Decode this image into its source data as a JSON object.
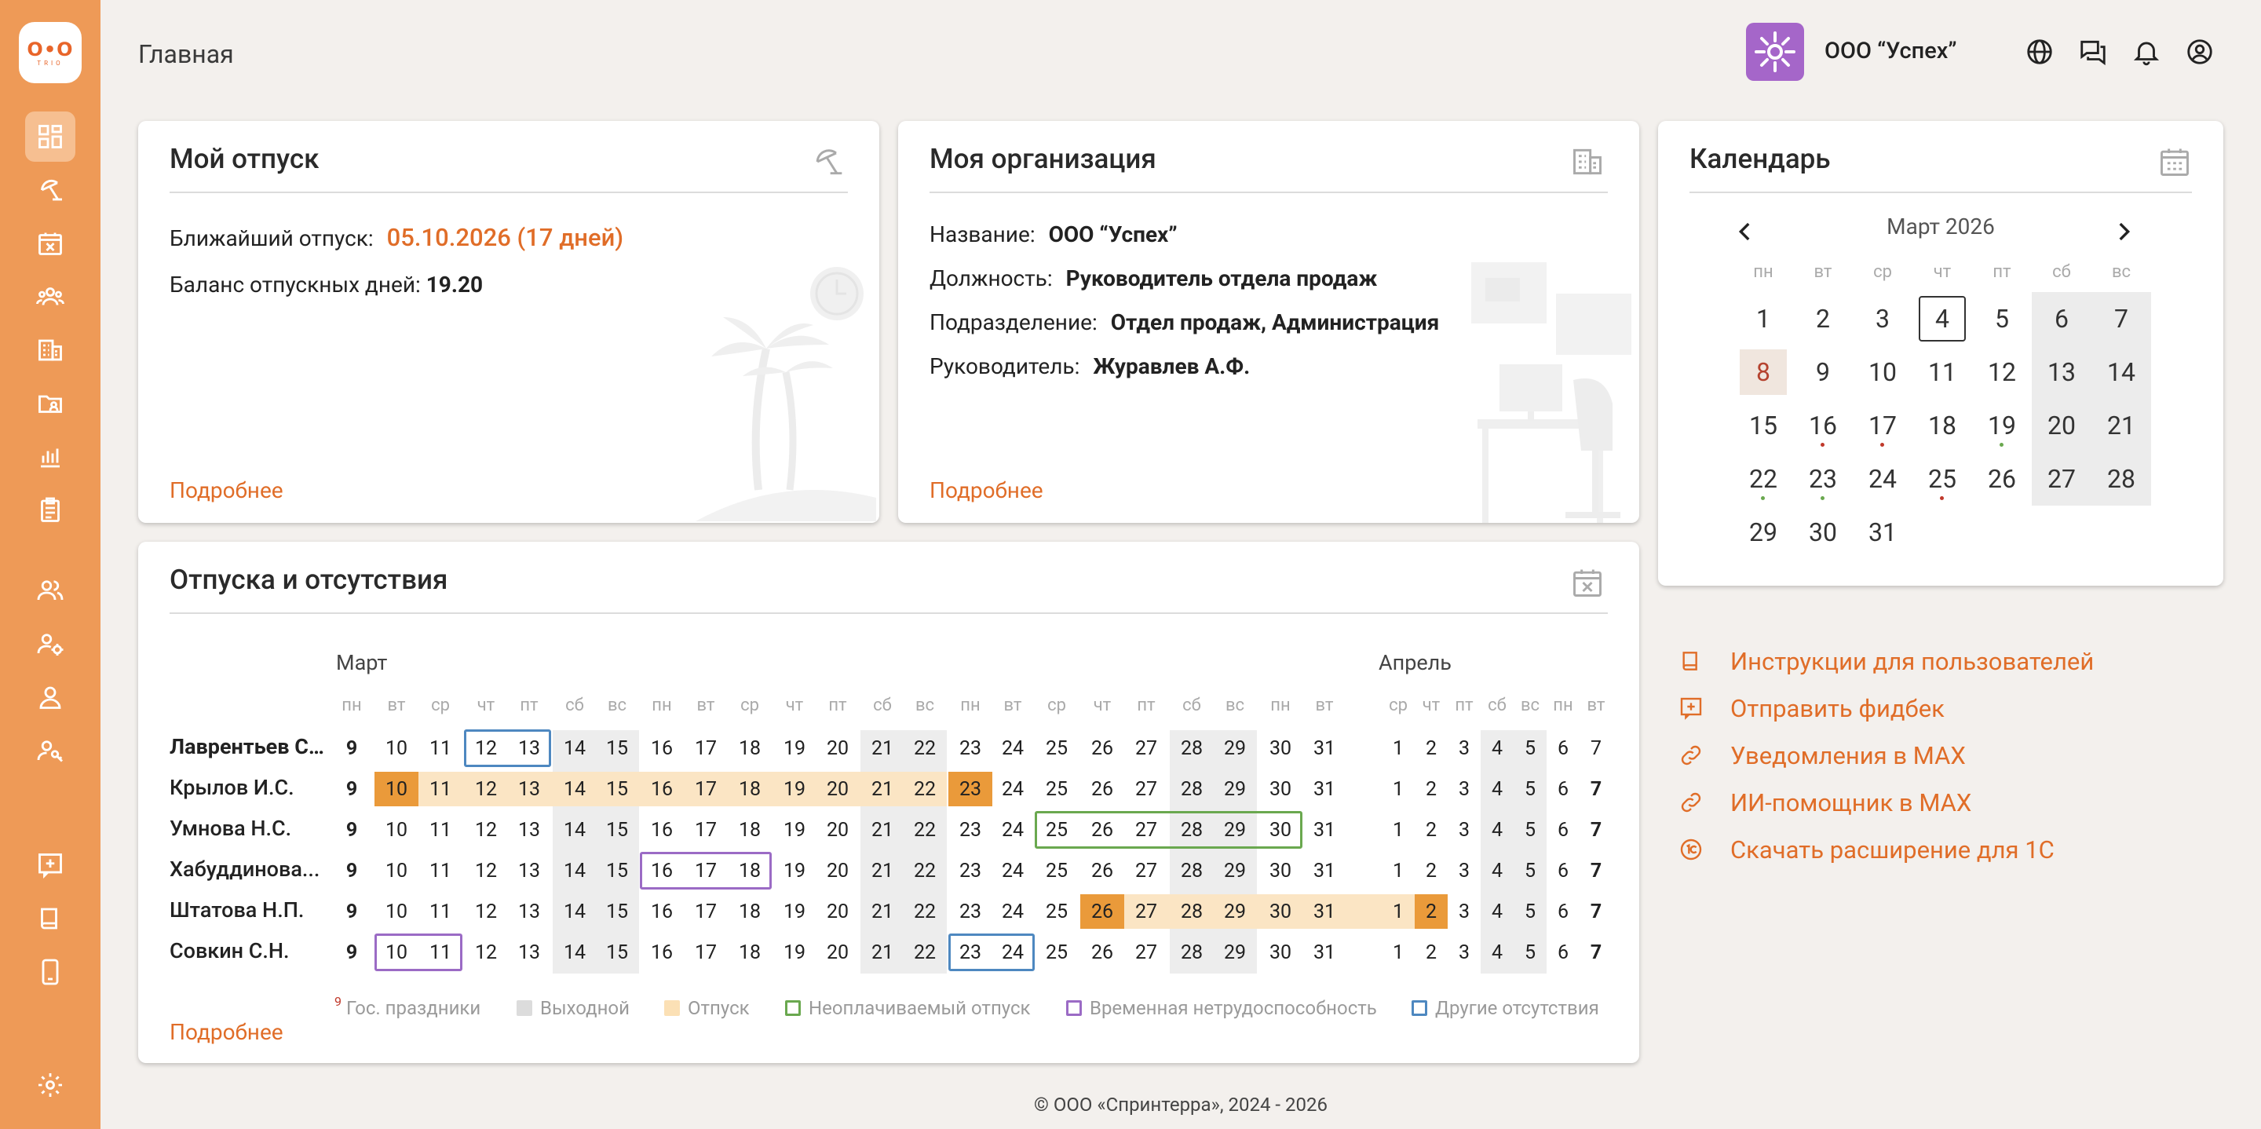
{
  "app": {
    "logo_text": "O•O",
    "logo_sub": "TRIO"
  },
  "header": {
    "page_title": "Главная",
    "org_name": "ООО “Успех”",
    "icons": [
      "globe-icon",
      "chat-icon",
      "bell-icon",
      "account-icon"
    ]
  },
  "sidebar": {
    "items": [
      "dashboard-icon",
      "umbrella-icon",
      "calendar-x-icon",
      "team-icon",
      "building-icon",
      "folder-icon",
      "chart-icon",
      "clipboard-icon",
      "users-icon",
      "user-settings-icon",
      "user-icon",
      "user-key-icon",
      "feedback-icon",
      "book-icon",
      "phone-icon",
      "gear-icon"
    ]
  },
  "vacation_card": {
    "title": "Мой отпуск",
    "nearest_label": "Ближайший отпуск:",
    "nearest_value": "05.10.2026 (17 дней)",
    "balance_label": "Баланс отпускных дней:",
    "balance_value": "19.20",
    "more": "Подробнее"
  },
  "org_card": {
    "title": "Моя организация",
    "rows": [
      {
        "label": "Название:",
        "value": "ООО “Успех”"
      },
      {
        "label": "Должность:",
        "value": "Руководитель отдела продаж"
      },
      {
        "label": "Подразделение:",
        "value": "Отдел продаж, Администрация"
      },
      {
        "label": "Руководитель:",
        "value": "Журавлев А.Ф."
      }
    ],
    "more": "Подробнее"
  },
  "calendar_card": {
    "title": "Календарь",
    "month": "Март 2026",
    "weekdays": [
      "пн",
      "вт",
      "ср",
      "чт",
      "пт",
      "сб",
      "вс"
    ],
    "weeks": [
      [
        "1",
        "2",
        "3",
        "4",
        "5",
        "6",
        "7"
      ],
      [
        "8",
        "9",
        "10",
        "11",
        "12",
        "13",
        "14"
      ],
      [
        "15",
        "16",
        "17",
        "18",
        "19",
        "20",
        "21"
      ],
      [
        "22",
        "23",
        "24",
        "25",
        "26",
        "27",
        "28"
      ],
      [
        "29",
        "30",
        "31",
        "",
        "",
        "",
        ""
      ]
    ],
    "today": "4",
    "holiday": "8"
  },
  "absences_card": {
    "title": "Отпуска и отсутствия",
    "month_march": "Март",
    "month_april": "Апрель",
    "day_headers_march": [
      "пн",
      "вт",
      "ср",
      "чт",
      "пт",
      "сб",
      "вс",
      "пн",
      "вт",
      "ср",
      "чт",
      "пт",
      "сб",
      "вс",
      "пн",
      "вт",
      "ср",
      "чт",
      "пт",
      "сб",
      "вс",
      "пн",
      "вт"
    ],
    "day_headers_april": [
      "ср",
      "чт",
      "пт",
      "сб",
      "вс",
      "пн",
      "вт"
    ],
    "march_days": [
      "9",
      "10",
      "11",
      "12",
      "13",
      "14",
      "15",
      "16",
      "17",
      "18",
      "19",
      "20",
      "21",
      "22",
      "23",
      "24",
      "25",
      "26",
      "27",
      "28",
      "29",
      "30",
      "31"
    ],
    "april_days": [
      "1",
      "2",
      "3",
      "4",
      "5",
      "6",
      "7"
    ],
    "employees": [
      "Лаврентьев С...",
      "Крылов И.С.",
      "Умнова Н.С.",
      "Хабуддинова...",
      "Штатова Н.П.",
      "Совкин С.Н."
    ],
    "legend": [
      "Гос. праздники",
      "Выходной",
      "Отпуск",
      "Неоплачиваемый отпуск",
      "Временная нетрудоспособность",
      "Другие отсутствия"
    ],
    "legend_holiday_mark": "9",
    "more": "Подробнее"
  },
  "links": [
    {
      "icon": "book-icon",
      "label": "Инструкции для пользователей"
    },
    {
      "icon": "feedback-icon",
      "label": "Отправить фидбек"
    },
    {
      "icon": "link-icon",
      "label": "Уведомления в MAX"
    },
    {
      "icon": "link-icon",
      "label": "ИИ-помощник в MAX"
    },
    {
      "icon": "1c-icon",
      "label": "Скачать расширение для 1С"
    }
  ],
  "footer": "© ООО «Спринтерра», 2024 - 2026",
  "colors": {
    "accent": "#ee9a57",
    "link": "#e06d28",
    "vacation": "#fbe5c4",
    "vacation_dark": "#ea9a3a",
    "weekend": "#ececec",
    "unpaid": "#6aa84f",
    "sick": "#9b6bc5",
    "other": "#4e88c0"
  }
}
